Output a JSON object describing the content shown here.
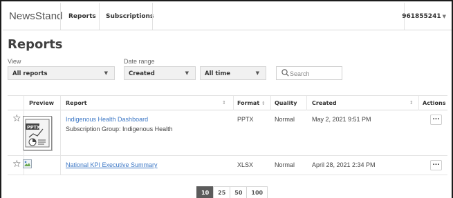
{
  "app": {
    "brand": "NewsStand",
    "user": "961855241"
  },
  "nav": {
    "tabs": [
      {
        "label": "Reports"
      },
      {
        "label": "Subscriptions"
      }
    ]
  },
  "page": {
    "title": "Reports"
  },
  "filters": {
    "view_label": "View",
    "view_value": "All reports",
    "date_range_label": "Date range",
    "date_field_value": "Created",
    "date_period_value": "All time",
    "search_placeholder": "Search"
  },
  "table": {
    "columns": [
      "Preview",
      "Report",
      "Format",
      "Quality",
      "Created",
      "Actions"
    ],
    "rows": [
      {
        "title": "Indigenous Health Dashboard",
        "subtitle": "Subscription Group: Indigenous Health",
        "format": "PPTX",
        "quality": "Normal",
        "created": "May 2, 2021 9:51 PM",
        "action": "...",
        "thumb_label": "PPTX"
      },
      {
        "title": "National KPI Executive Summary",
        "format": "XLSX",
        "quality": "Normal",
        "created": "April 28, 2021 2:34 PM",
        "action": "..."
      }
    ]
  },
  "pagination": {
    "sizes": [
      "10",
      "25",
      "50",
      "100"
    ],
    "selected": "10"
  },
  "colors": {
    "link": "#3d78c6",
    "active_page": "#5b5b5b",
    "text": "#333333"
  },
  "icons": {
    "favorite": "star-outline-icon",
    "search": "magnifier-icon",
    "caret": "triangle-down-icon"
  }
}
